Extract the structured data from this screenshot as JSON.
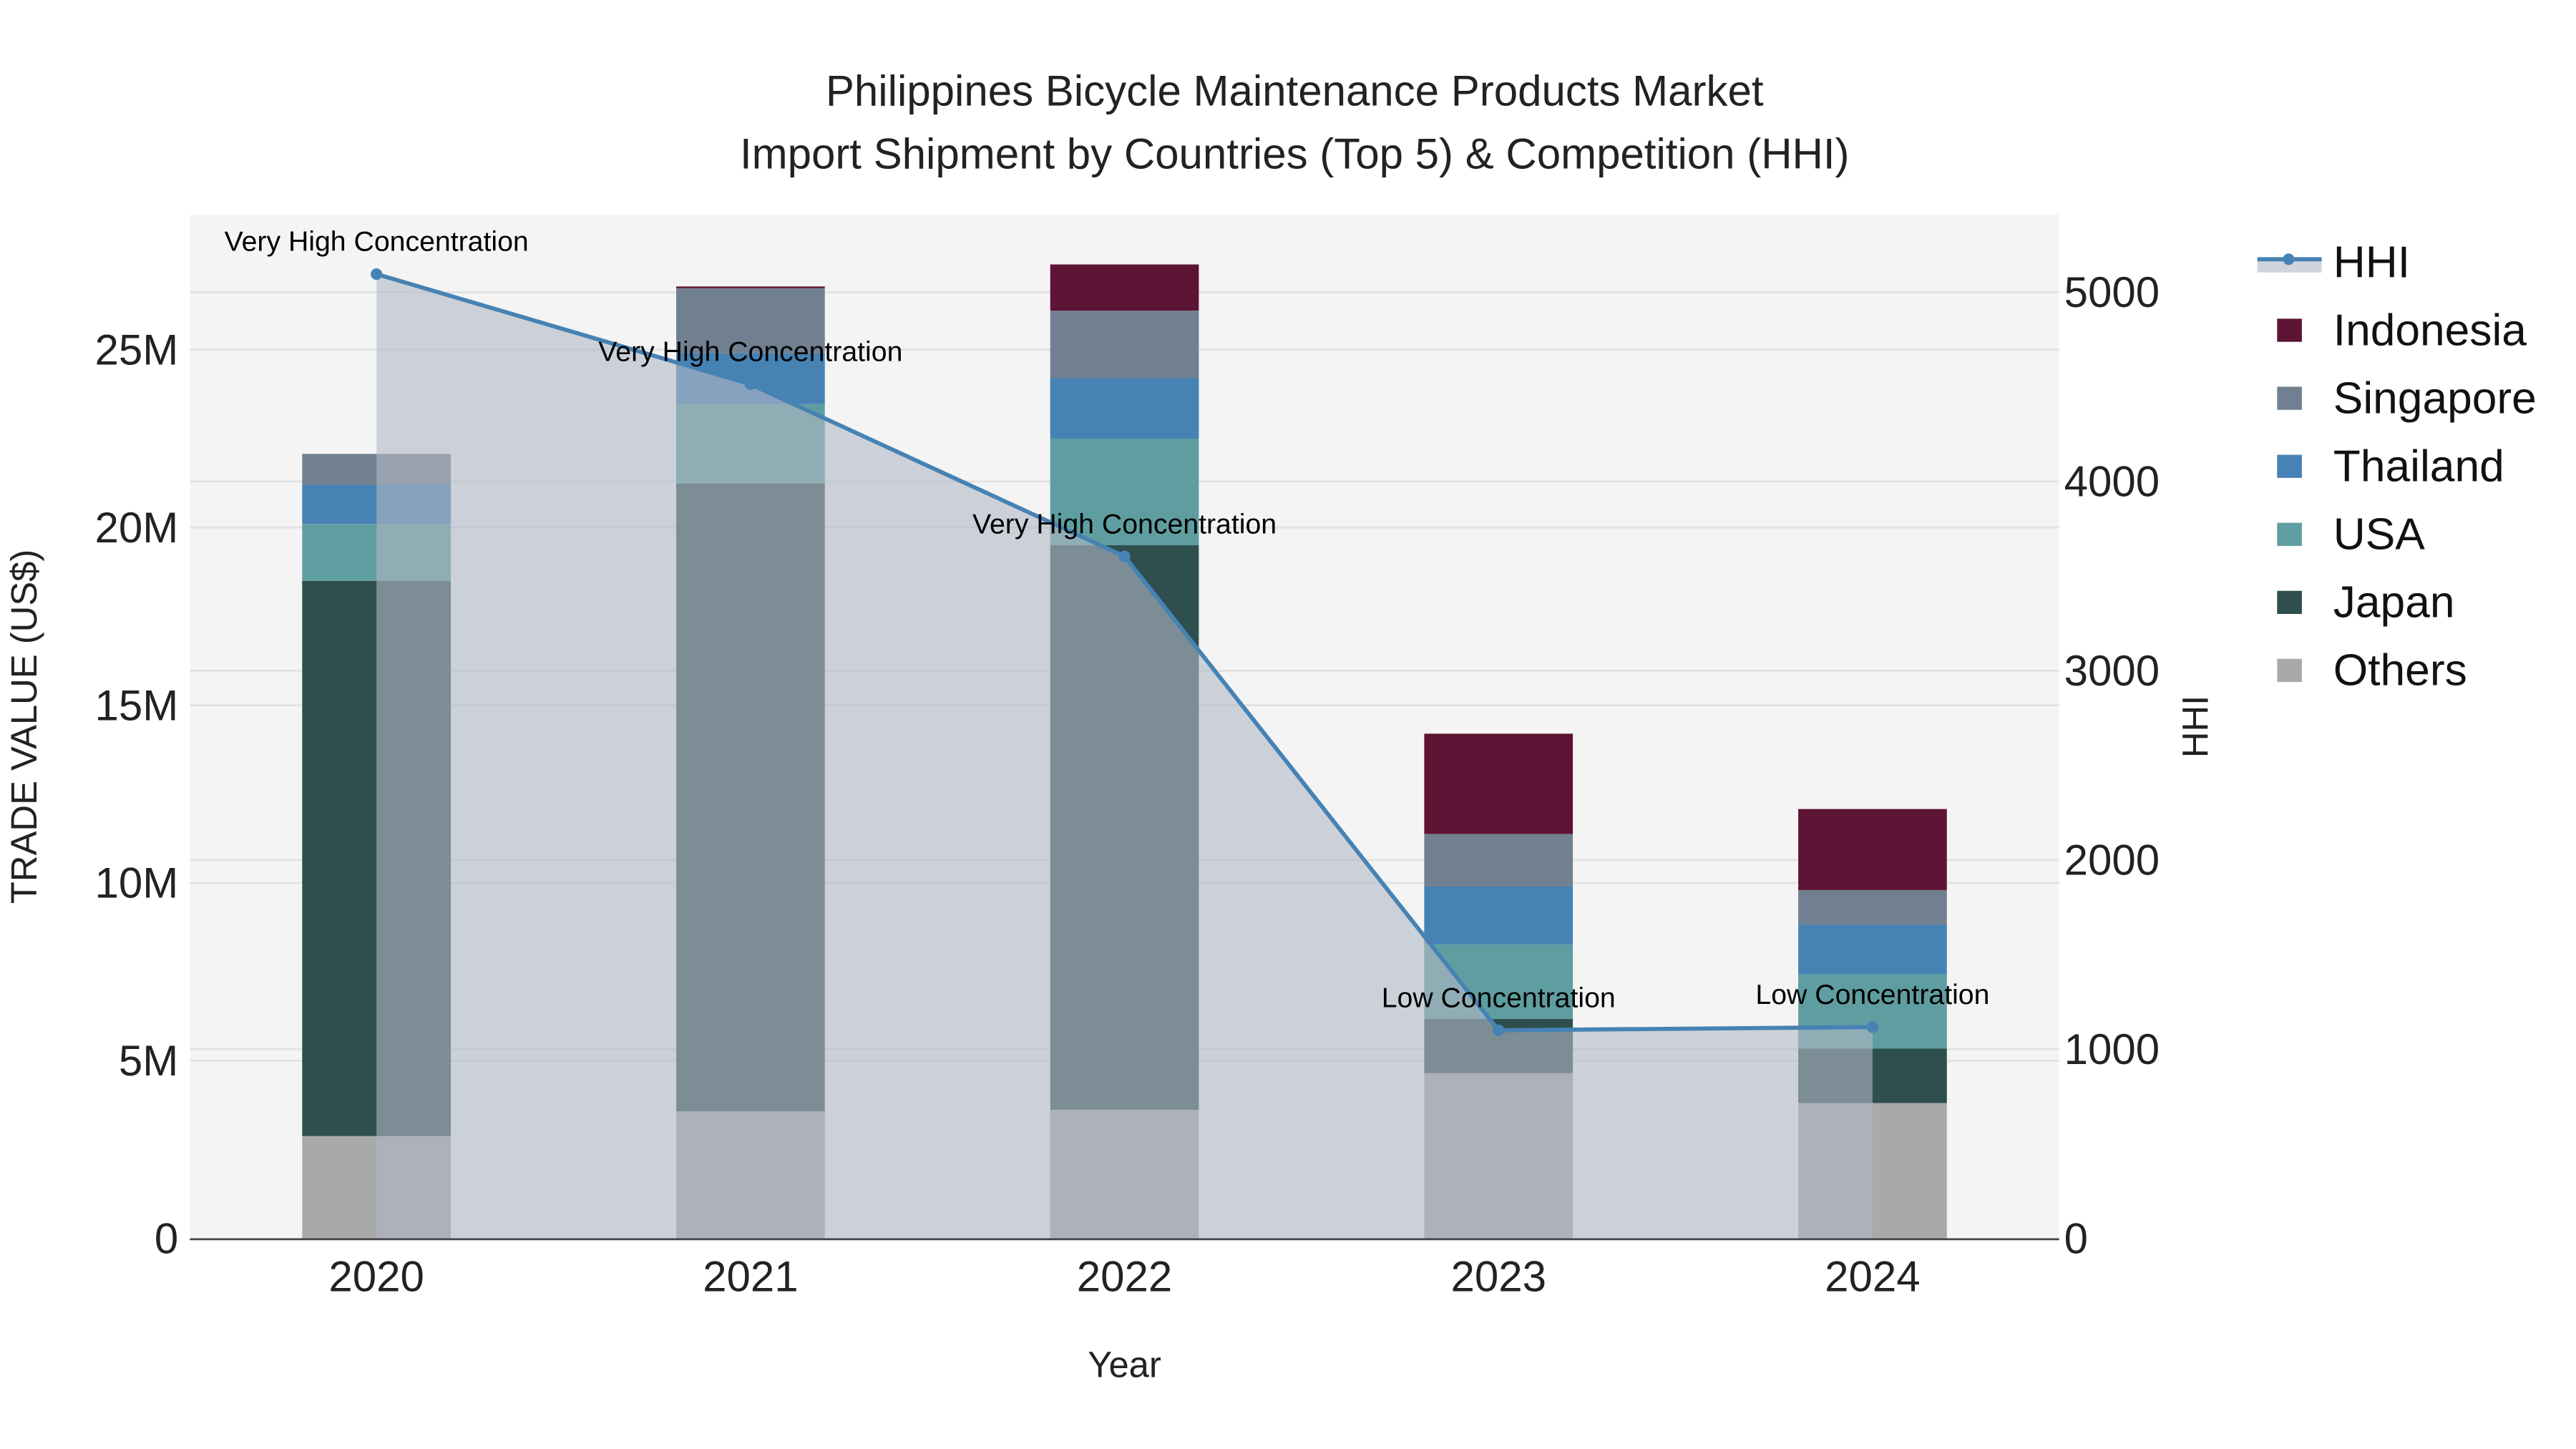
{
  "chart_data": {
    "type": "bar",
    "barmode": "stack",
    "title": "Philippines Bicycle Maintenance Products Market",
    "subtitle": "Import Shipment by Countries (Top 5) & Competition (HHI)",
    "xlabel": "Year",
    "ylabel": "TRADE VALUE (US$)",
    "y2label": "HHI",
    "categories": [
      "2020",
      "2021",
      "2022",
      "2023",
      "2024"
    ],
    "ylim": [
      0,
      28800000
    ],
    "y2lim": [
      0,
      5410
    ],
    "yticks": [
      {
        "v": 0,
        "label": "0"
      },
      {
        "v": 5000000,
        "label": "5M"
      },
      {
        "v": 10000000,
        "label": "10M"
      },
      {
        "v": 15000000,
        "label": "15M"
      },
      {
        "v": 20000000,
        "label": "20M"
      },
      {
        "v": 25000000,
        "label": "25M"
      }
    ],
    "y2ticks": [
      {
        "v": 0,
        "label": "0"
      },
      {
        "v": 1000,
        "label": "1000"
      },
      {
        "v": 2000,
        "label": "2000"
      },
      {
        "v": 3000,
        "label": "3000"
      },
      {
        "v": 4000,
        "label": "4000"
      },
      {
        "v": 5000,
        "label": "5000"
      }
    ],
    "grid": true,
    "legend_position": "right",
    "series": [
      {
        "name": "Others",
        "color": "#a9a9a9",
        "values": [
          2880000,
          3580000,
          3620000,
          4650000,
          3810000
        ]
      },
      {
        "name": "Japan",
        "color": "#2f4f4f",
        "values": [
          15620000,
          17660000,
          15880000,
          1530000,
          1530000
        ]
      },
      {
        "name": "USA",
        "color": "#5f9ea0",
        "values": [
          1600000,
          2230000,
          3000000,
          2090000,
          2090000
        ]
      },
      {
        "name": "Thailand",
        "color": "#4682b4",
        "values": [
          1100000,
          1430000,
          1700000,
          1630000,
          1400000
        ]
      },
      {
        "name": "Singapore",
        "color": "#708090",
        "values": [
          870000,
          1830000,
          1900000,
          1480000,
          970000
        ]
      },
      {
        "name": "Indonesia",
        "color": "#5e1434",
        "values": [
          0,
          50000,
          1300000,
          2820000,
          2280000
        ]
      }
    ],
    "hhi": {
      "name": "HHI",
      "color": "#4682b4",
      "fill": "#b0b8c4",
      "values": [
        5096,
        4514,
        3604,
        1100,
        1117
      ],
      "annotations": [
        "Very High Concentration",
        "Very High Concentration",
        "Very High Concentration",
        "Low Concentration",
        "Low Concentration"
      ]
    }
  }
}
